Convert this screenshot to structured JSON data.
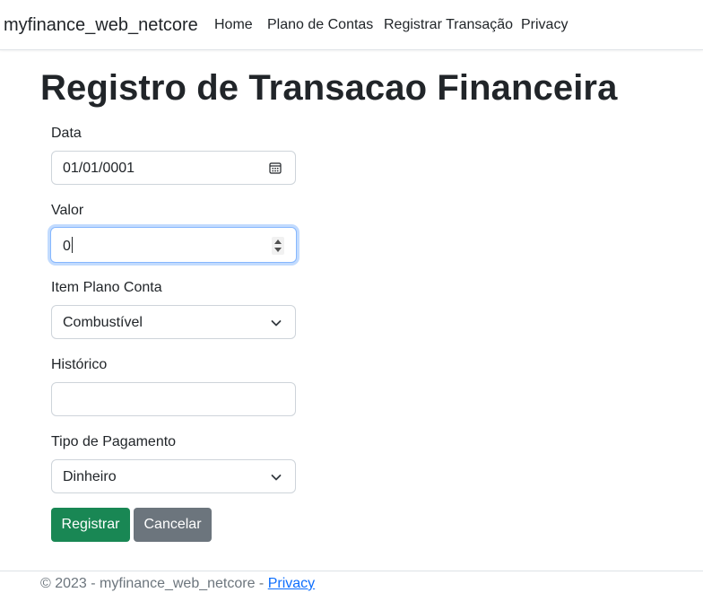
{
  "navbar": {
    "brand": "myfinance_web_netcore",
    "links": [
      "Home",
      "Plano de Contas",
      "Registrar Transação",
      "Privacy"
    ]
  },
  "page": {
    "title": "Registro de Transacao Financeira"
  },
  "form": {
    "data": {
      "label": "Data",
      "value": "01/01/0001"
    },
    "valor": {
      "label": "Valor",
      "value": "0"
    },
    "item_plano_conta": {
      "label": "Item Plano Conta",
      "selected": "Combustível"
    },
    "historico": {
      "label": "Histórico",
      "value": ""
    },
    "tipo_pagamento": {
      "label": "Tipo de Pagamento",
      "selected": "Dinheiro"
    },
    "submit_label": "Registrar",
    "cancel_label": "Cancelar"
  },
  "footer": {
    "copyright": "© 2023 - myfinance_web_netcore - ",
    "privacy_link": "Privacy"
  },
  "colors": {
    "success": "#198754",
    "secondary": "#6c757d",
    "link": "#0d6efd",
    "focus_border": "#86b7fe"
  },
  "icons": [
    "calendar-icon",
    "spinner-arrows",
    "chevron-down-icon"
  ]
}
